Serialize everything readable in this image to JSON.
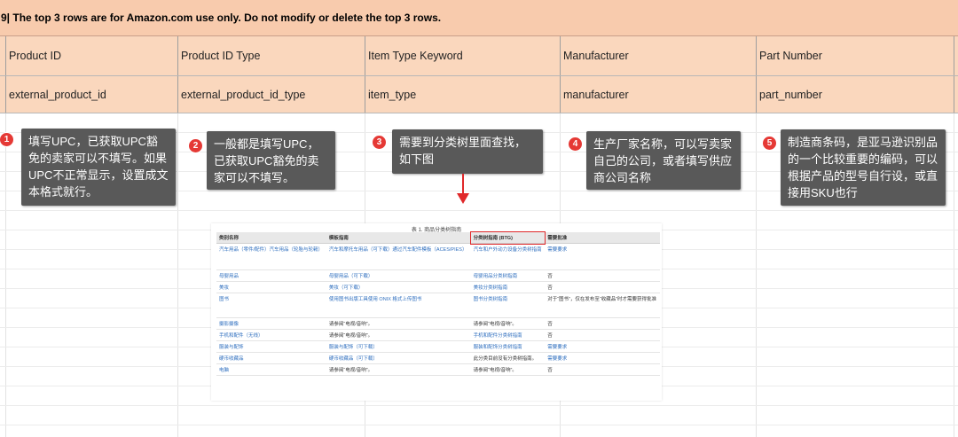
{
  "banner": {
    "text": "9| The top 3 rows are for Amazon.com use only. Do not modify or delete the top 3 rows."
  },
  "columns": [
    {
      "label": "Product ID",
      "field": "external_product_id"
    },
    {
      "label": "Product ID Type",
      "field": "external_product_id_type"
    },
    {
      "label": "Item Type Keyword",
      "field": "item_type"
    },
    {
      "label": "Manufacturer",
      "field": "manufacturer"
    },
    {
      "label": "Part Number",
      "field": "part_number"
    }
  ],
  "callouts": [
    {
      "num": "1",
      "text": "填写UPC，已获取UPC豁免的卖家可以不填写。如果UPC不正常显示，设置成文本格式就行。"
    },
    {
      "num": "2",
      "text": "一般都是填写UPC，已获取UPC豁免的卖家可以不填写。"
    },
    {
      "num": "3",
      "text": "需要到分类树里面查找，如下图"
    },
    {
      "num": "4",
      "text": "生产厂家名称，可以写卖家自己的公司，或者填写供应商公司名称"
    },
    {
      "num": "5",
      "text": "制造商条码，是亚马逊识别品的一个比较重要的编码，可以根据产品的型号自行设，或直接用SKU也行"
    }
  ],
  "embedded_table": {
    "caption": "表 1. 商品分类树指南",
    "headers": [
      "类别名称",
      "模板指南",
      "分类树指南 (BTG)",
      "需要批准"
    ],
    "rows": [
      [
        "汽车用品（零件/配件）汽车用品（轮胎与轮毂）",
        "汽车和摩托车用品（可下载）通过汽车配件模板（ACES/PIES）",
        "汽车和户外动力设备分类树指南",
        "需要要求"
      ],
      [
        "母婴用品",
        "母婴用品（可下载）",
        "母婴用品分类树指南",
        "否"
      ],
      [
        "美妆",
        "美妆（可下载）",
        "美妆分类树指南",
        "否"
      ],
      [
        "图书",
        "使用图书出版工具使用 ONIX 格式上传图书",
        "图书分类树指南",
        "对于“图书”，仅在发布至“收藏品”时才需要获得批准"
      ],
      [
        "摄影摄像",
        "请参阅“电视/音响”。",
        "请参阅“电视/音响”。",
        "否"
      ],
      [
        "手机和配件（无线）",
        "请参阅“电视/音响”。",
        "手机和配件分类树指南",
        "否"
      ],
      [
        "服装与配饰",
        "服装与配饰（可下载）",
        "服装和配饰分类树指南",
        "需要要求"
      ],
      [
        "硬币收藏品",
        "硬币收藏品（可下载）",
        "此分类目前没有分类树指南。",
        "需要要求"
      ],
      [
        "电脑",
        "请参阅“电视/音响”。",
        "请参阅“电视/音响”。",
        "否"
      ]
    ]
  },
  "colors": {
    "banner_bg": "#f8cbad",
    "header_bg": "#fad7bd",
    "callout_bg": "#595959",
    "badge": "#e53935",
    "arrow": "#e0282a"
  }
}
